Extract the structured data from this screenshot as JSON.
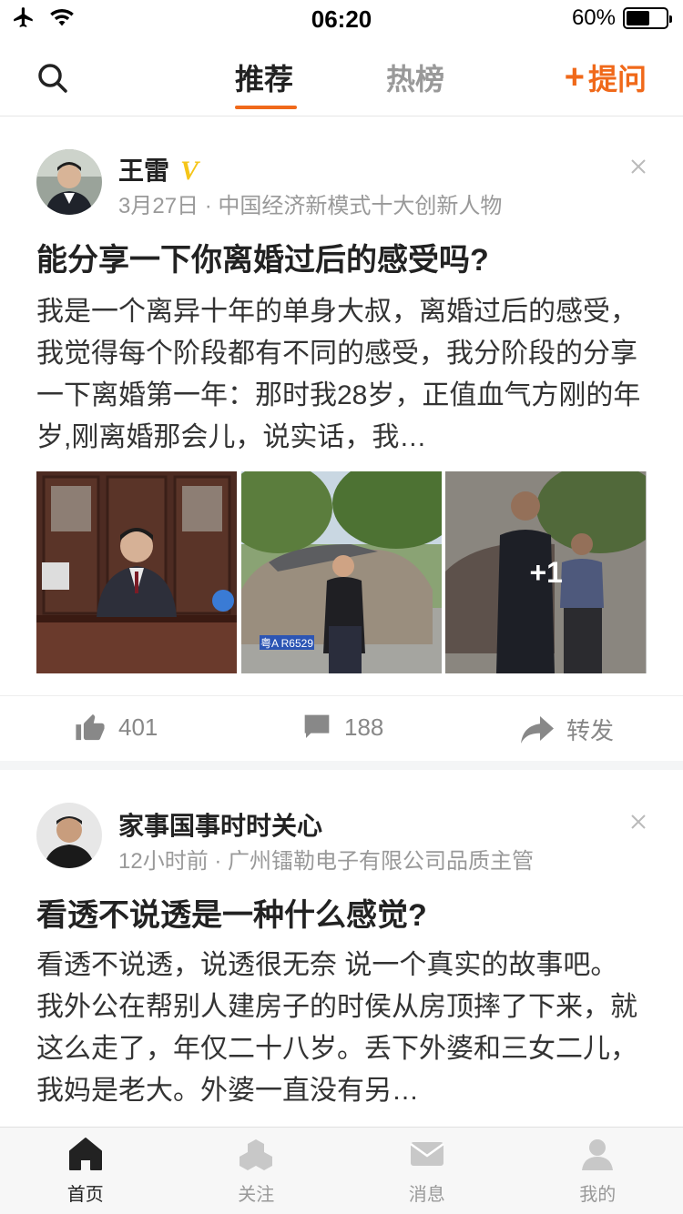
{
  "status_bar": {
    "time": "06:20",
    "battery_percent": "60%",
    "battery_level": 0.6
  },
  "header": {
    "tabs": [
      {
        "label": "推荐",
        "active": true
      },
      {
        "label": "热榜",
        "active": false
      }
    ],
    "ask_label": "提问",
    "ask_prefix": "+",
    "accent_color": "#f0691a"
  },
  "feed": [
    {
      "author": "王雷",
      "verified": "V",
      "meta": "3月27日 · 中国经济新模式十大创新人物",
      "title": "能分享一下你离婚过后的感受吗?",
      "excerpt": "我是一个离异十年的单身大叔，离婚过后的感受，我觉得每个阶段都有不同的感受，我分阶段的分享一下离婚第一年：那时我28岁，正值血气方刚的年岁,刚离婚那会儿，说实话，我…",
      "photo_more": "+1",
      "plate_text": "粤A R6529",
      "likes": "401",
      "comments": "188",
      "share_label": "转发"
    },
    {
      "author": "家事国事时时关心",
      "meta": "12小时前 · 广州镭勒电子有限公司品质主管",
      "title": "看透不说透是一种什么感觉?",
      "excerpt": "看透不说透，说透很无奈  说一个真实的故事吧。 我外公在帮别人建房子的时侯从房顶摔了下来，就这么走了，年仅二十八岁。丢下外婆和三女二儿，我妈是老大。外婆一直没有另…"
    }
  ],
  "tab_bar": {
    "items": [
      {
        "label": "首页",
        "icon": "home-icon",
        "active": true
      },
      {
        "label": "关注",
        "icon": "follow-icon",
        "active": false
      },
      {
        "label": "消息",
        "icon": "message-icon",
        "active": false
      },
      {
        "label": "我的",
        "icon": "profile-icon",
        "active": false
      }
    ]
  }
}
